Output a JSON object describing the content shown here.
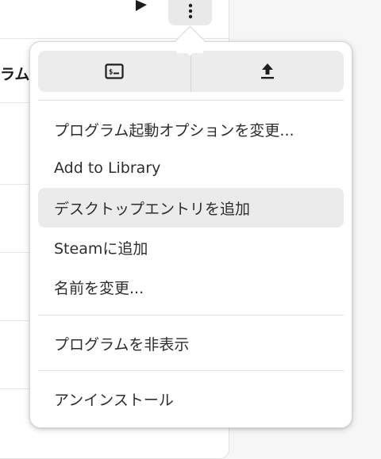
{
  "background": {
    "visible_label": "ラム"
  },
  "popover": {
    "icons": {
      "terminal": "terminal-icon",
      "upload": "upload-icon"
    },
    "menu_items": [
      {
        "label": "プログラム起動オプションを変更..."
      },
      {
        "label": "Add to Library"
      },
      {
        "label": "デスクトップエントリを追加"
      },
      {
        "label": "Steamに追加"
      },
      {
        "label": "名前を変更..."
      },
      {
        "label": "プログラムを非表示"
      },
      {
        "label": "アンインストール"
      }
    ],
    "hovered_item": "デスクトップエントリを追加"
  },
  "colors": {
    "popover_bg": "#ffffff",
    "icon_bar_bg": "#ececec",
    "hover_bg": "#ebebeb",
    "page_bg": "#f6f6f6"
  }
}
